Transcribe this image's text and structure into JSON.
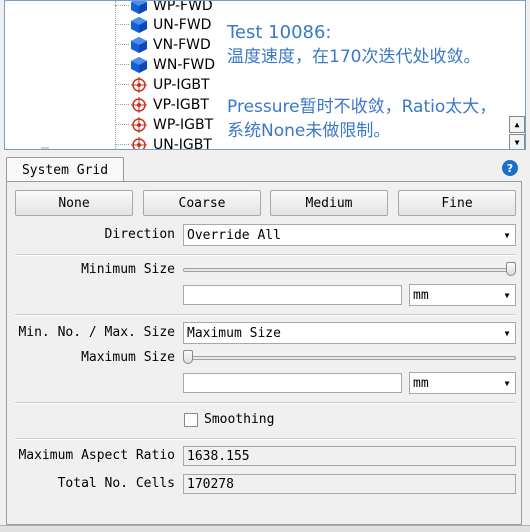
{
  "tree": {
    "items": [
      {
        "label": "WP-FWD",
        "icon": "cube-icon"
      },
      {
        "label": "UN-FWD",
        "icon": "cube-icon"
      },
      {
        "label": "VN-FWD",
        "icon": "cube-icon"
      },
      {
        "label": "WN-FWD",
        "icon": "cube-icon"
      },
      {
        "label": "UP-IGBT",
        "icon": "target-icon"
      },
      {
        "label": "VP-IGBT",
        "icon": "target-icon"
      },
      {
        "label": "WP-IGBT",
        "icon": "target-icon"
      },
      {
        "label": "UN-IGBT",
        "icon": "target-icon"
      }
    ]
  },
  "overlay": {
    "line1": "Test 10086:",
    "line2": "温度速度，在170次迭代处收敛。",
    "line3": "Pressure暂时不收敛，Ratio太大，",
    "line4": "系统None未做限制。"
  },
  "tab": {
    "label": "System Grid"
  },
  "buttons": {
    "none": "None",
    "coarse": "Coarse",
    "medium": "Medium",
    "fine": "Fine"
  },
  "direction": {
    "label": "Direction",
    "value": "Override All"
  },
  "minimum_size": {
    "label": "Minimum Size",
    "slider_fraction": 1.0,
    "value": "",
    "unit": "mm"
  },
  "minmax": {
    "label": "Min. No. / Max. Size",
    "value": "Maximum Size"
  },
  "maximum_size": {
    "label": "Maximum Size",
    "slider_fraction": 0.0,
    "value": "",
    "unit": "mm"
  },
  "smoothing": {
    "label": "Smoothing",
    "checked": false
  },
  "aspect_ratio": {
    "label": "Maximum Aspect Ratio",
    "value": "1638.155"
  },
  "total_cells": {
    "label": "Total No. Cells",
    "value": "170278"
  },
  "colors": {
    "accent": "#1c6fc8",
    "overlay_text": "#3a78c8",
    "cube": "#1560d8",
    "target": "#c83020"
  }
}
